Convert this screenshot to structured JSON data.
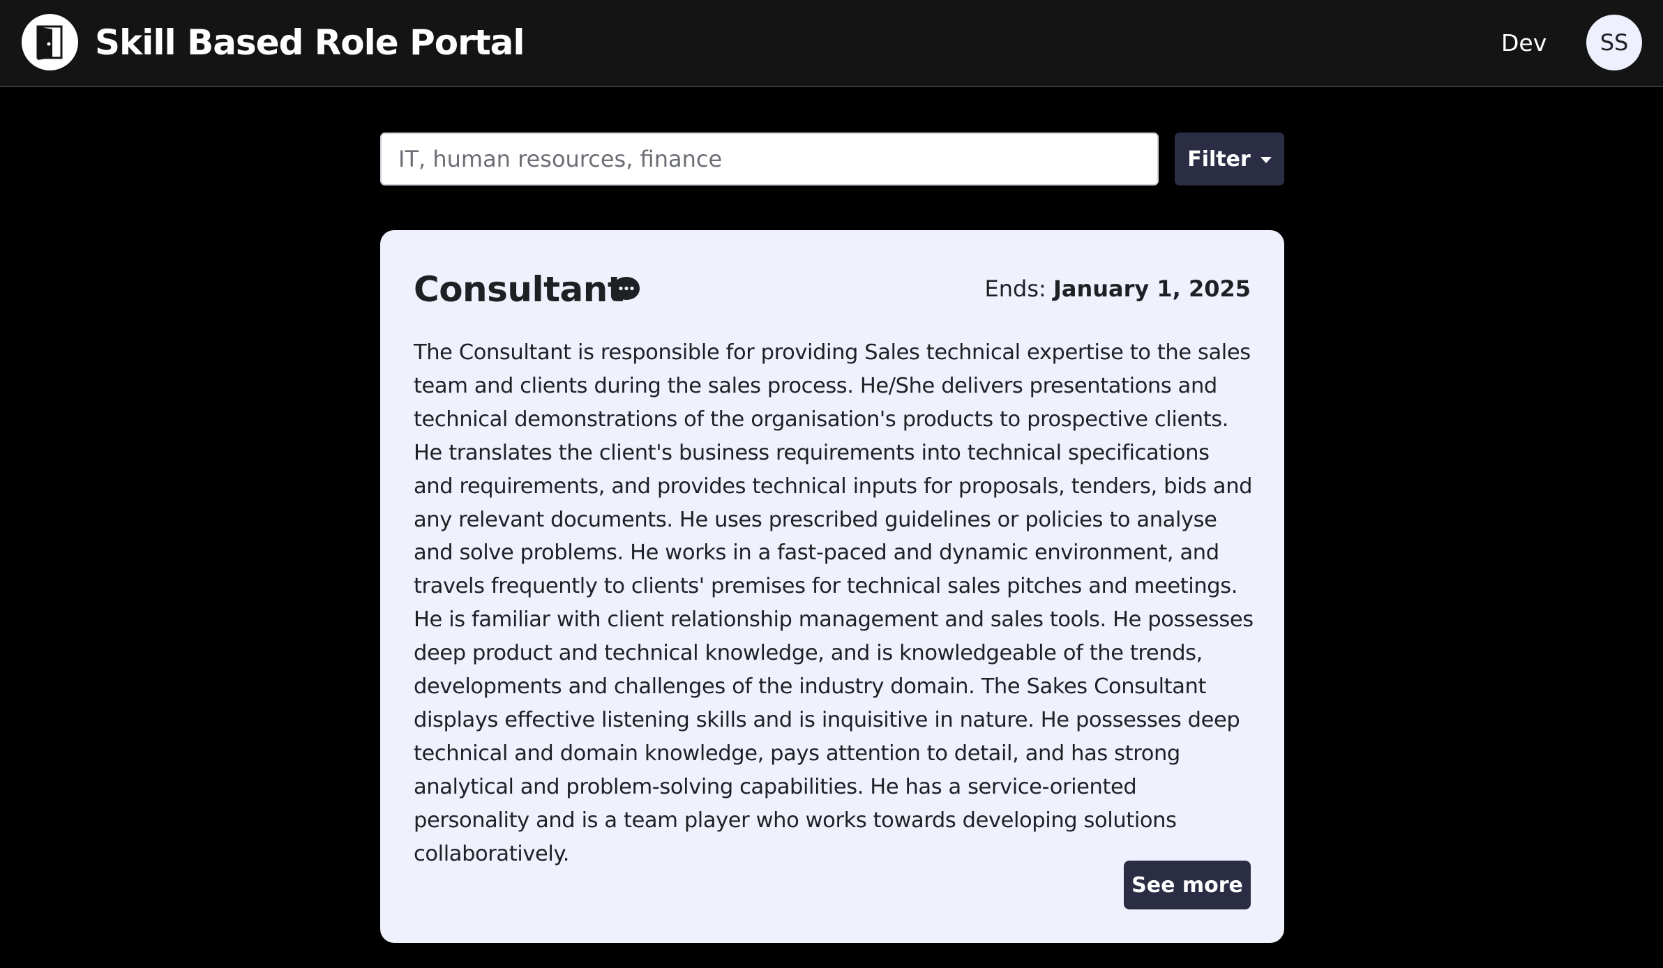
{
  "header": {
    "app_title": "Skill Based Role Portal",
    "logo_icon": "door-icon",
    "nav_link": "Dev",
    "avatar_initials": "SS"
  },
  "search": {
    "placeholder": "IT, human resources, finance",
    "value": "",
    "filter_label": "Filter"
  },
  "role_card": {
    "title": "Consultant",
    "comment_icon": "chat-bubble-icon",
    "ends_label": "Ends:",
    "ends_date": "January 1, 2025",
    "description": "The Consultant is responsible for providing Sales technical expertise to the sales team and clients during the sales process. He/She delivers presentations and technical demonstrations of the organisation's products to prospective clients. He translates the client's business requirements into technical specifications and requirements, and provides technical inputs for proposals, tenders, bids and any relevant documents. He uses prescribed guidelines or policies to analyse and solve problems. He works in a fast-paced and dynamic environment, and travels frequently to clients' premises for technical sales pitches and meetings. He is familiar with client relationship management and sales tools. He possesses deep product and technical knowledge, and is knowledgeable of the trends, developments and challenges of the industry domain. The Sakes Consultant displays effective listening skills and is inquisitive in nature. He possesses deep technical and domain knowledge, pays attention to detail, and has strong analytical and problem-solving capabilities. He has a service-oriented personality and is a team player who works towards developing solutions collaboratively.",
    "see_more_label": "See more"
  },
  "colors": {
    "navbar_bg": "#141414",
    "page_bg": "#000000",
    "card_bg": "#eff2fd",
    "button_bg": "#2b2d45",
    "avatar_bg": "#eef1fd"
  }
}
